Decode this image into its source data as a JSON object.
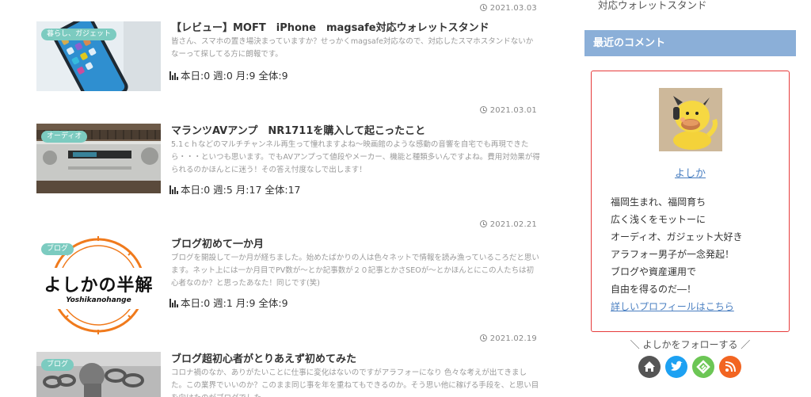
{
  "posts": [
    {
      "date": "2021.03.03",
      "category": "暮らし、ガジェット",
      "title": "【レビュー】MOFT　iPhone　magsafe対応ウォレットスタンド",
      "excerpt": "皆さん、スマホの置き場決まっていますか？せっかくmagsafe対応なので、対応したスマホスタンドないかなーって探してる方に朗報です。",
      "views": "本日:0 週:0 月:9 全体:9"
    },
    {
      "date": "2021.03.01",
      "category": "オーディオ",
      "title": "マランツAVアンプ　NR1711を購入して起こったこと",
      "excerpt": "5.1ｃｈなどのマルチチャンネル再生って憧れますよね〜映画館のような感動の音響を自宅でも再現できたら・・・といつも思います。でもAVアンプって値段やメーカー、機能と種類多いんですよね。費用対効果が得られるのかほんとに迷う！その答え忖度なしで出します！",
      "views": "本日:0 週:5 月:17 全体:17"
    },
    {
      "date": "2021.02.21",
      "category": "ブログ",
      "title": "ブログ初めて一か月",
      "excerpt": "ブログを開設して一か月が経ちました。始めたばかりの人は色々ネットで情報を読み漁っているころだと思います。ネット上には一か月目でPV数が〜とか記事数が２０記事とかさSEOが〜とかほんとにこの人たちは初心者なのか？と思ったあなた！同じです(笑)",
      "views": "本日:0 週:1 月:9 全体:9",
      "thumb_text": "よしかの半解",
      "thumb_sub": "Yoshikanohange"
    },
    {
      "date": "2021.02.19",
      "category": "ブログ",
      "title": "ブログ超初心者がとりあえず初めてみた",
      "excerpt": "コロナ禍のなか、ありがたいことに仕事に変化はないのですがアラフォーになり 色々な考えが出てきました。この業界でいいのか？このまま同じ事を年を重ねてもできるのか。そう思い他に稼げる手段を、と思い目を向けたのがブログでした。",
      "views": ""
    }
  ],
  "sidebar": {
    "prev_item": "対応ウォレットスタンド",
    "recent_comments_heading": "最近のコメント",
    "profile": {
      "name": "よしか",
      "bio_lines": [
        "福岡生まれ、福岡育ち",
        "広く浅くをモットーに",
        "オーディオ、ガジェット大好き",
        "アラフォー男子が一念発起！",
        "ブログや資産運用で",
        "自由を得るのだ―！"
      ],
      "profile_link": "詳しいプロフィールはこちら"
    },
    "follow_text": "＼ よしかをフォローする ／",
    "social_icons": [
      "home-icon",
      "twitter-icon",
      "feedly-icon",
      "rss-icon"
    ],
    "social_colors": [
      "#555555",
      "#1da1f2",
      "#6cc655",
      "#f26522"
    ]
  },
  "colors": {
    "accent": "#8bafd8",
    "category_badge": "#7ccbc0",
    "profile_border": "#e63b3b",
    "link": "#4a7fc1"
  }
}
